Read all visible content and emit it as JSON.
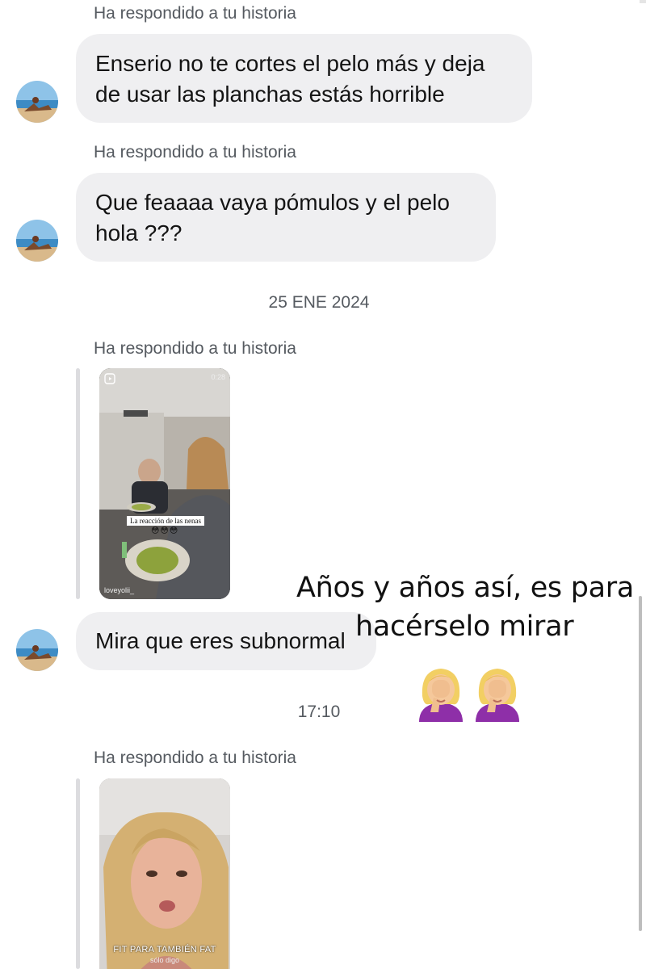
{
  "messages": [
    {
      "reply_label": "Ha respondido a tu historia",
      "text_lines": [
        "Enserio no te cortes el pelo más y deja",
        "de usar las planchas estás horrible"
      ]
    },
    {
      "reply_label": "Ha respondido a tu historia",
      "text_lines": [
        "Que feaaaa vaya pómulos y el pelo",
        "hola ???"
      ]
    },
    {
      "date_separator": "25 ENE 2024",
      "reply_label": "Ha respondido a tu historia",
      "story": {
        "duration": "0:28",
        "caption": "La reacción de las nenas",
        "emojis": "😳😳😳",
        "handle": "loveyolii_"
      },
      "text": "Mira que eres subnormal"
    },
    {
      "time_separator": "17:10",
      "reply_label": "Ha respondido a tu historia",
      "story": {
        "caption": "FIT PARA TAMBIÉN FAT",
        "subcaption": "sólo digo"
      }
    }
  ],
  "overlay": {
    "line1": "Años y años así, es para",
    "line2": "hacérselo mirar",
    "emoji": "🤦‍♀️🤦‍♀️"
  },
  "colors": {
    "bubble": "#efeff1",
    "label": "#555a60",
    "background": "#ffffff"
  }
}
